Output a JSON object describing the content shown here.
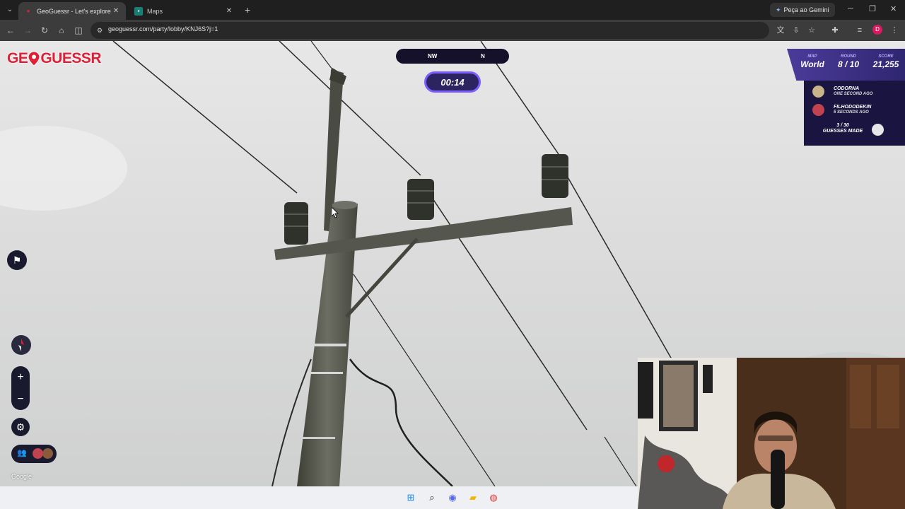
{
  "browser": {
    "tabs": [
      {
        "title": "GeoGuessr - Let's explore the w",
        "active": true,
        "favicon": "geoguessr-pin-icon"
      },
      {
        "title": "Maps",
        "active": false,
        "favicon": "maps-icon"
      }
    ],
    "new_tab_symbol": "+",
    "gemini_label": "Peça ao Gemini",
    "url": "geoguessr.com/party/lobby/KNJ6S?j=1",
    "profile_initial": "D"
  },
  "game": {
    "logo_text_left": "GE",
    "logo_text_right": "GUESSR",
    "compass": {
      "left_label": "NW",
      "right_label": "N"
    },
    "timer": "00:14",
    "stats": {
      "map_label": "MAP",
      "map_value": "World",
      "round_label": "ROUND",
      "round_value": "8 / 10",
      "score_label": "SCORE",
      "score_value": "21,255"
    },
    "players": [
      {
        "name": "CODORNA",
        "time": "ONE SECOND AGO",
        "color": "#c9b48a"
      },
      {
        "name": "FILHODODEKIN",
        "time": "5 SECONDS AGO",
        "color": "#c0434f"
      }
    ],
    "guesses_count": "3 / 30",
    "guesses_label": "GUESSES MADE",
    "zoom_in": "+",
    "zoom_out": "−",
    "google_attribution": "Google",
    "accent": "#7c5cff"
  }
}
